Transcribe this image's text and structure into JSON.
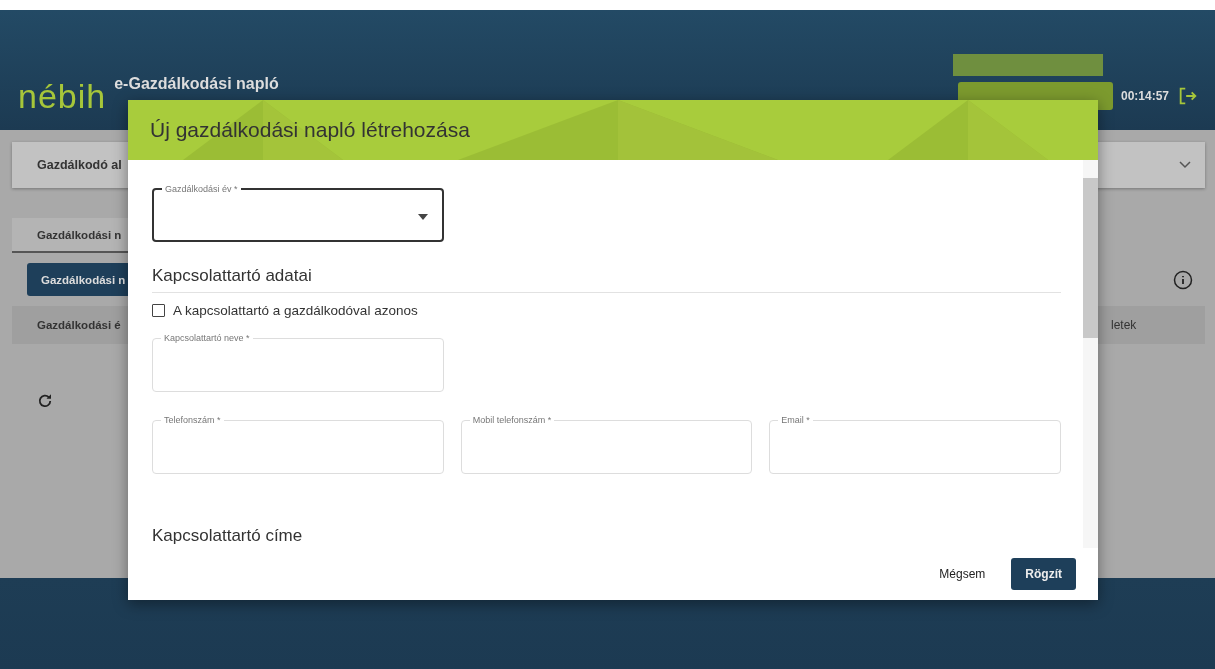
{
  "header": {
    "logo": "nébih",
    "app_title": "e-Gazdálkodási napló",
    "timer": "00:14:57"
  },
  "background": {
    "farmer_card": "Gazdálkodó al",
    "tab": "Gazdálkodási n",
    "action_button": "Gazdálkodási n",
    "table_header": [
      "Gazdálkodási é",
      "letek"
    ]
  },
  "dialog": {
    "title": "Új gazdálkodási napló létrehozása",
    "year_field": {
      "label": "Gazdálkodási év *",
      "kind": "select",
      "focused": true
    },
    "contact_heading": "Kapcsolattartó adatai",
    "same_as_farmer": {
      "label": "A kapcsolattartó a gazdálkodóval azonos",
      "checked": false
    },
    "name_field": {
      "label": "Kapcsolattartó neve *",
      "focused": false
    },
    "phone_fields": [
      {
        "label": "Telefonszám *",
        "focused": false
      },
      {
        "label": "Mobil telefonszám *",
        "focused": false
      },
      {
        "label": "Email *",
        "focused": false
      }
    ],
    "address_heading": "Kapcsolattartó címe",
    "cancel": "Mégsem",
    "submit": "Rögzít"
  }
}
